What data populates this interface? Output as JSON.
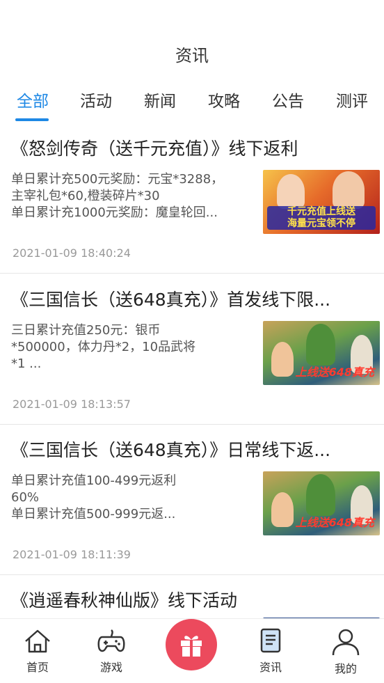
{
  "header": {
    "title": "资讯"
  },
  "tabs": [
    {
      "label": "全部",
      "active": true
    },
    {
      "label": "活动"
    },
    {
      "label": "新闻"
    },
    {
      "label": "攻略"
    },
    {
      "label": "公告"
    },
    {
      "label": "测评"
    }
  ],
  "articles": [
    {
      "title": "《怒剑传奇（送千元充值）》线下返利",
      "desc": [
        "单日累计充500元奖励：元宝*3288，",
        "主宰礼包*60,橙装碎片*30",
        "单日累计充1000元奖励：魔皇轮回..."
      ],
      "time": "2021-01-09 18:40:24",
      "thumb_text": "千元充值上线送\n海量元宝领不停"
    },
    {
      "title": "《三国信长（送648真充）》首发线下限...",
      "desc": [
        "三日累计充值250元：银币",
        "*500000，体力丹*2，10品武将",
        "*1         ..."
      ],
      "time": "2021-01-09 18:13:57",
      "thumb_text": "上线送648真充"
    },
    {
      "title": "《三国信长（送648真充）》日常线下返...",
      "desc": [
        "单日累计充值100-499元返利",
        "60%",
        "单日累计充值500-999元返..."
      ],
      "time": "2021-01-09 18:11:39",
      "thumb_text": "上线送648真充"
    },
    {
      "title": "《逍遥春秋神仙版》线下活动",
      "desc": [],
      "time": "",
      "thumb_text": ""
    }
  ],
  "tabbar": {
    "home": "首页",
    "games": "游戏",
    "news": "资讯",
    "mine": "我的"
  },
  "colors": {
    "accent": "#1e88e5",
    "gift": "#ec4a5d"
  }
}
